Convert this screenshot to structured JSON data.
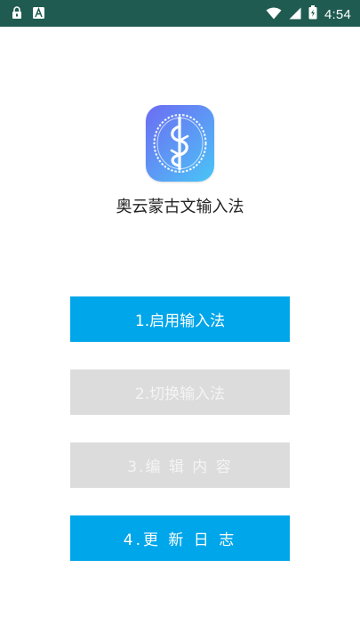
{
  "status_bar": {
    "time": "4:54",
    "left_icons": [
      "lock-icon",
      "font-a-icon"
    ],
    "right_icons": [
      "wifi-icon",
      "signal-icon",
      "battery-icon"
    ],
    "background_color": "#1f5b50"
  },
  "app": {
    "name": "奥云蒙古文输入法",
    "icon": "app-logo-icon"
  },
  "menu": {
    "items": [
      {
        "label": "1.启用输入法",
        "state": "enabled"
      },
      {
        "label": "2.切换输入法",
        "state": "disabled"
      },
      {
        "label": "3.编 辑 内 容",
        "state": "disabled"
      },
      {
        "label": "4.更 新 日 志",
        "state": "enabled"
      }
    ]
  },
  "colors": {
    "accent": "#00a6ea",
    "disabled": "#dcdcdc"
  }
}
